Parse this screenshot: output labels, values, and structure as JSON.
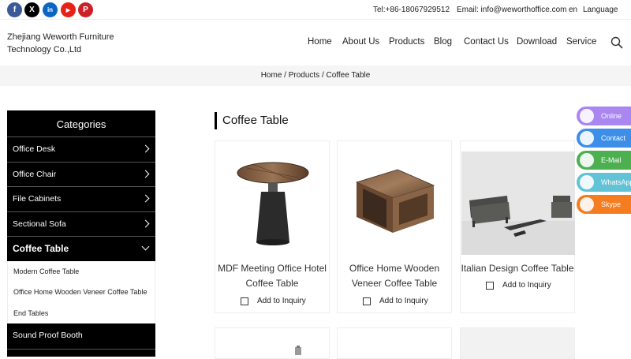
{
  "topbar": {
    "social": [
      {
        "name": "facebook-icon",
        "glyph": "f",
        "color": "#3b5998"
      },
      {
        "name": "x-twitter-icon",
        "glyph": "X",
        "color": "#000000"
      },
      {
        "name": "linkedin-icon",
        "glyph": "in",
        "color": "#0a66c2"
      },
      {
        "name": "youtube-icon",
        "glyph": "▶",
        "color": "#e62117"
      },
      {
        "name": "pinterest-icon",
        "glyph": "P",
        "color": "#cb2027"
      }
    ],
    "tel": "Tel:+86-18067929512",
    "email": "Email: info@weworthoffice.com",
    "lang_code": "en",
    "lang_label": "Language"
  },
  "header": {
    "company_line1": "Zhejiang Weworth Furniture",
    "company_line2": "Technology Co.,Ltd",
    "nav": [
      "Home",
      "About Us",
      "Products",
      "Blog",
      "Contact Us",
      "Download",
      "Service"
    ]
  },
  "breadcrumb": "Home / Products / Coffee Table",
  "sidebar": {
    "heading": "Categories",
    "items_top": [
      "Office Desk",
      "Office Chair",
      "File Cabinets",
      "Sectional Sofa"
    ],
    "active": "Coffee Table",
    "subitems": [
      "Modern Coffee Table",
      "Office Home Wooden Veneer Coffee Table",
      "End Tables"
    ],
    "items_bottom": [
      "Sound Proof Booth"
    ]
  },
  "main": {
    "title": "Coffee Table",
    "add_label": "Add to Inquiry",
    "products": [
      {
        "line1": "MDF Meeting Office Hotel",
        "line2": "Coffee Table"
      },
      {
        "line1": "Office Home Wooden",
        "line2": "Veneer Coffee Table"
      },
      {
        "line1": "Italian Design Coffee Table",
        "line2": ""
      }
    ]
  },
  "floating": [
    {
      "label": "Online",
      "color": "#a986f0"
    },
    {
      "label": "Contact",
      "color": "#3c8ee8"
    },
    {
      "label": "E-Mail",
      "color": "#4caf50"
    },
    {
      "label": "WhatsApp",
      "color": "#62c2d6"
    },
    {
      "label": "Skype",
      "color": "#f57c1f"
    }
  ]
}
